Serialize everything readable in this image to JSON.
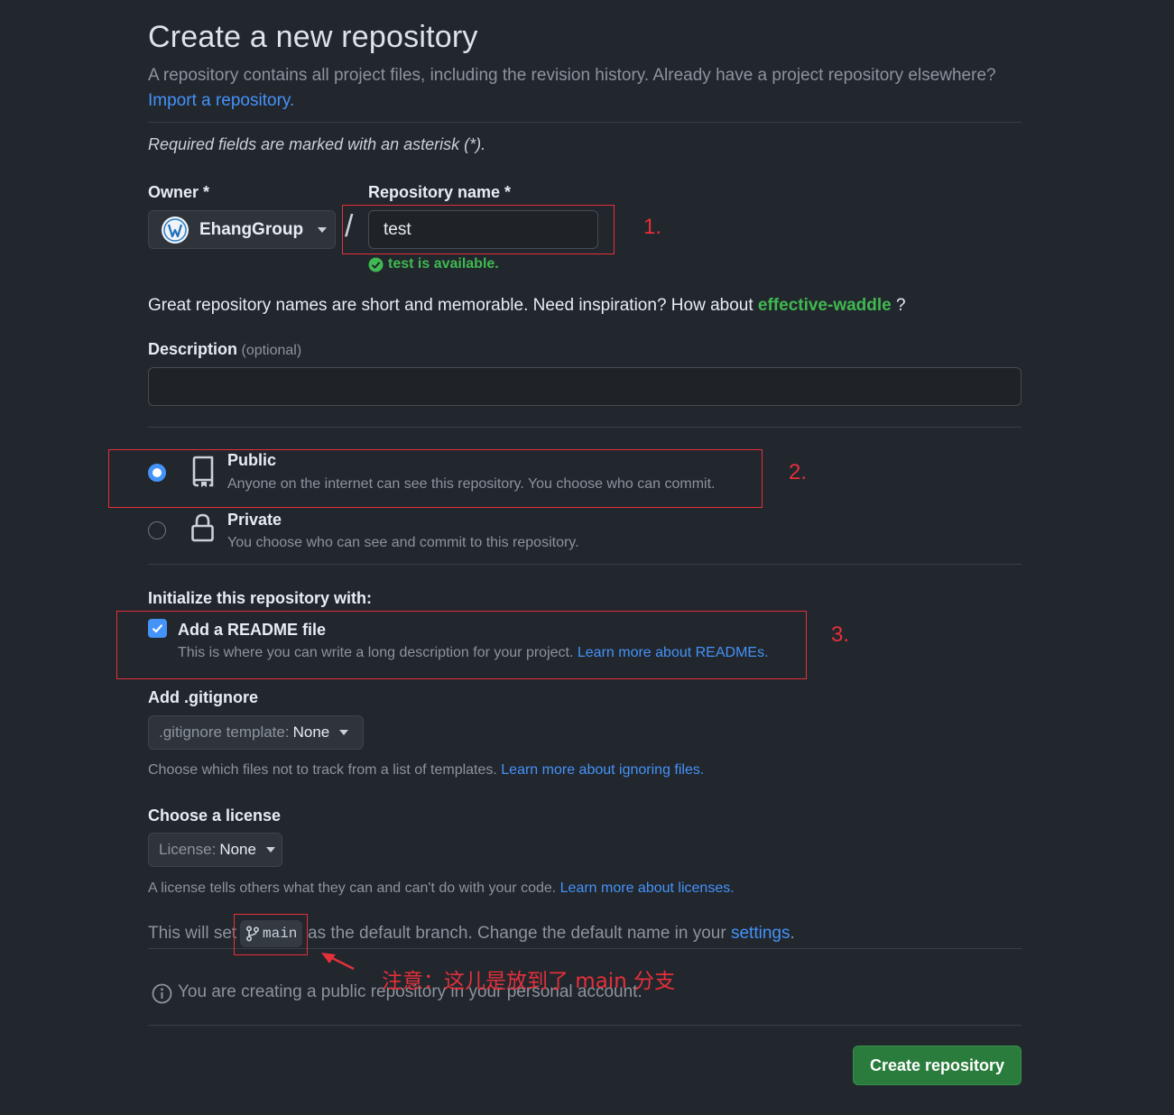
{
  "header": {
    "title": "Create a new repository",
    "subtitle": "A repository contains all project files, including the revision history. Already have a project repository elsewhere?",
    "import_link": "Import a repository."
  },
  "required_note": "Required fields are marked with an asterisk (*).",
  "owner": {
    "label": "Owner *",
    "value": "EhangGroup"
  },
  "repo_name": {
    "label": "Repository name *",
    "value": "test",
    "availability": "test is available."
  },
  "suggestion": {
    "prefix": "Great repository names are short and memorable. Need inspiration? How about",
    "name": "effective-waddle",
    "suffix": "?"
  },
  "description": {
    "label": "Description",
    "optional": "(optional)",
    "value": ""
  },
  "visibility": {
    "public": {
      "title": "Public",
      "desc": "Anyone on the internet can see this repository. You choose who can commit.",
      "selected": true
    },
    "private": {
      "title": "Private",
      "desc": "You choose who can see and commit to this repository.",
      "selected": false
    }
  },
  "initialize": {
    "label": "Initialize this repository with:",
    "readme_title": "Add a README file",
    "readme_desc": "This is where you can write a long description for your project.",
    "readme_link": "Learn more about READMEs.",
    "readme_checked": true
  },
  "gitignore": {
    "label": "Add .gitignore",
    "select_prefix": ".gitignore template:",
    "select_value": "None",
    "help": "Choose which files not to track from a list of templates.",
    "help_link": "Learn more about ignoring files."
  },
  "license": {
    "label": "Choose a license",
    "select_prefix": "License:",
    "select_value": "None",
    "help": "A license tells others what they can and can't do with your code.",
    "help_link": "Learn more about licenses."
  },
  "branch": {
    "prefix": "This will set",
    "name": "main",
    "middle": "as the default branch. Change the default name in your",
    "settings_link": "settings",
    "suffix": "."
  },
  "info_note": "You are creating a public repository in your personal account.",
  "create_button": "Create repository",
  "annotations": {
    "n1": "1.",
    "n2": "2.",
    "n3": "3.",
    "note": "注意：这儿是放到了 main 分支"
  },
  "colors": {
    "background": "#22262d",
    "accent_blue": "#4493f8",
    "success_green": "#3fb950",
    "primary_button": "#2a7c3c",
    "annotation_red": "#e5303a"
  }
}
